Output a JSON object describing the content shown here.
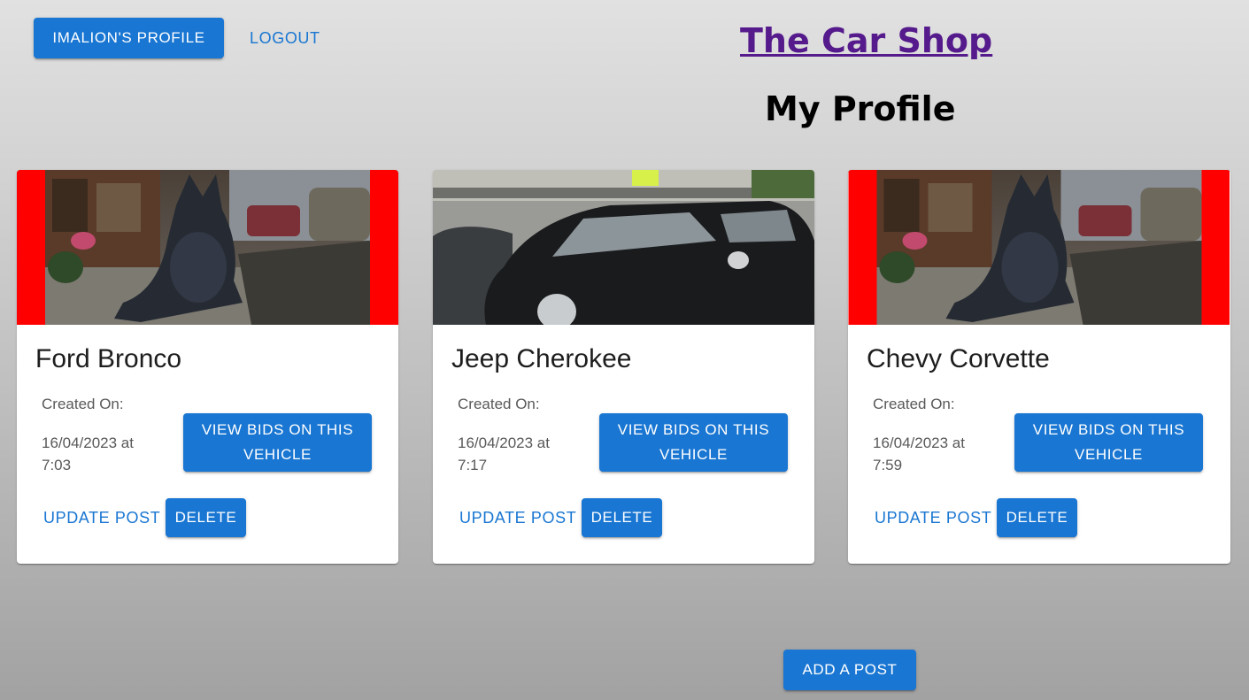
{
  "nav": {
    "profile_label": "IMALION'S PROFILE",
    "logout_label": "LOGOUT"
  },
  "site": {
    "title": "The Car Shop"
  },
  "page": {
    "heading": "My Profile"
  },
  "colors": {
    "primary": "#1976d2",
    "title_link": "#551a8b",
    "image_border_red": "#ff0000"
  },
  "posts": [
    {
      "title": "Ford Bronco",
      "created_label": "Created On:",
      "created_date": "16/04/2023 at 7:03",
      "view_bids_label": "VIEW BIDS ON THIS VEHICLE",
      "update_label": "UPDATE POST",
      "delete_label": "DELETE",
      "image": "cat-statue-photo"
    },
    {
      "title": "Jeep Cherokee",
      "created_label": "Created On:",
      "created_date": "16/04/2023 at 7:17",
      "view_bids_label": "VIEW BIDS ON THIS VEHICLE",
      "update_label": "UPDATE POST",
      "delete_label": "DELETE",
      "image": "black-porsche-photo"
    },
    {
      "title": "Chevy Corvette",
      "created_label": "Created On:",
      "created_date": "16/04/2023 at 7:59",
      "view_bids_label": "VIEW BIDS ON THIS VEHICLE",
      "update_label": "UPDATE POST",
      "delete_label": "DELETE",
      "image": "cat-statue-photo"
    }
  ],
  "actions": {
    "add_post_label": "ADD A POST"
  }
}
